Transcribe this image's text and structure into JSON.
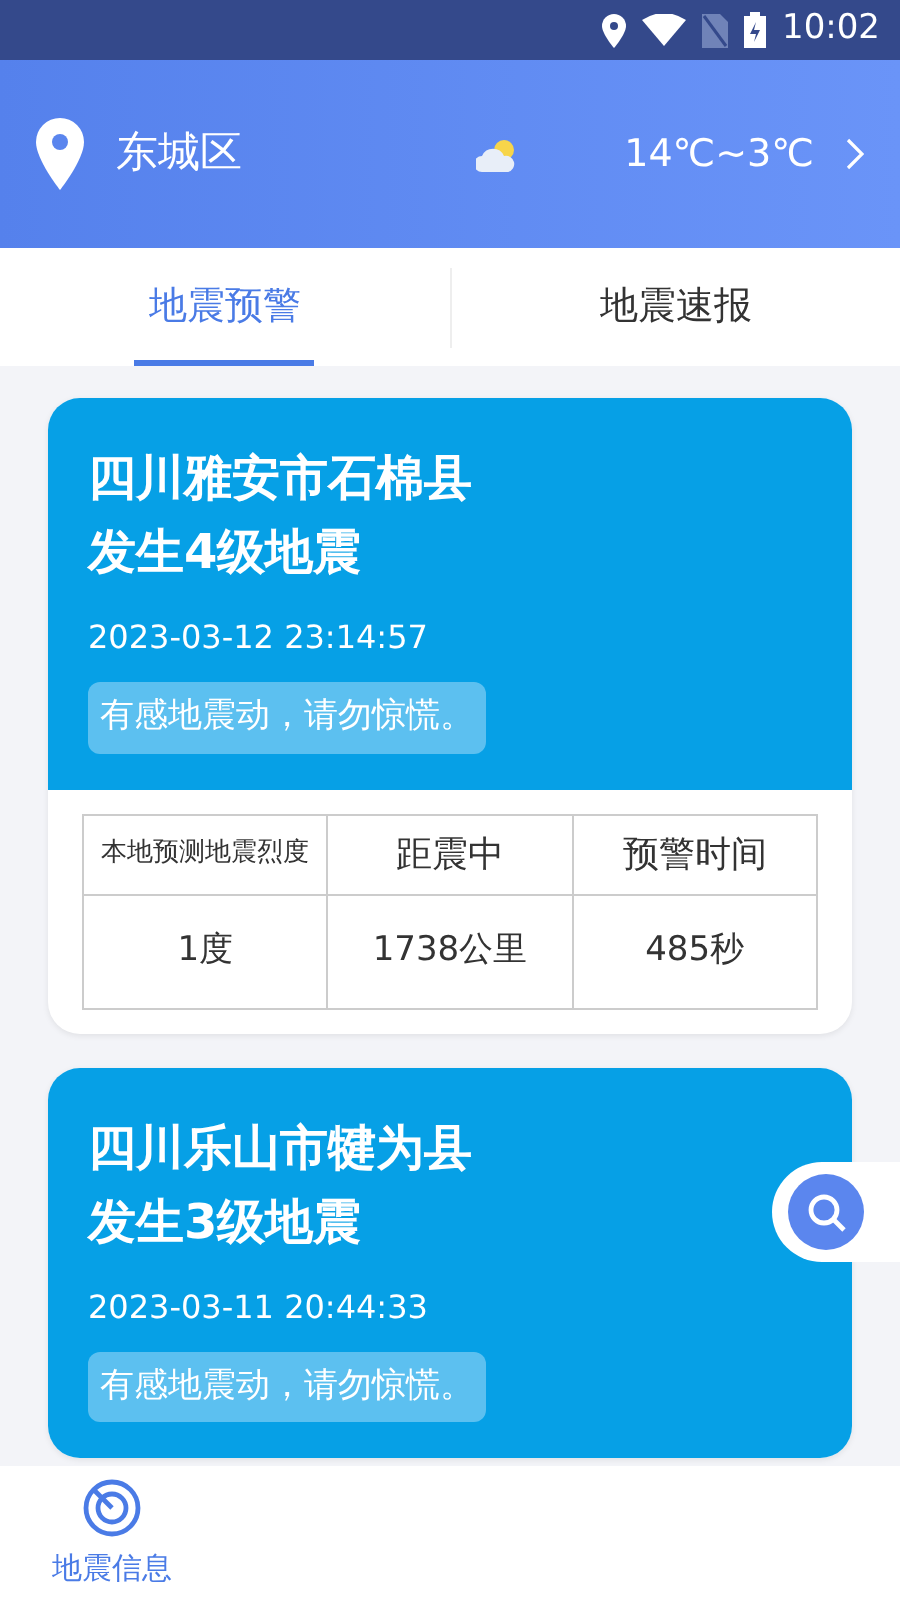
{
  "status_bar": {
    "time": "10:02"
  },
  "header": {
    "location": "东城区",
    "temperature": "14℃~3℃"
  },
  "tabs": [
    {
      "label": "地震预警",
      "selected": true
    },
    {
      "label": "地震速报",
      "selected": false
    }
  ],
  "alerts": [
    {
      "title": "四川雅安市石棉县发生4级地震",
      "time": "2023-03-12 23:14:57",
      "notice": "有感地震动，请勿惊慌。",
      "table": {
        "columns": [
          "本地预测地震烈度",
          "距震中",
          "预警时间"
        ],
        "values": [
          "1度",
          "1738公里",
          "485秒"
        ]
      }
    },
    {
      "title": "四川乐山市犍为县发生3级地震",
      "time": "2023-03-11 20:44:33",
      "notice": "有感地震动，请勿惊慌。"
    }
  ],
  "bottom_nav": [
    {
      "label": "地震信息",
      "selected": true
    }
  ]
}
